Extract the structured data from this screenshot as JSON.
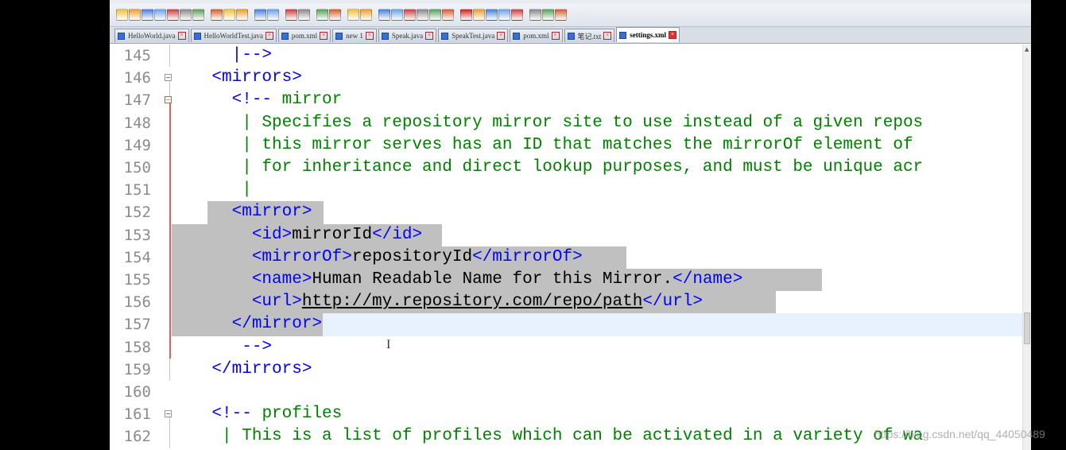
{
  "toolbar": {
    "buttons": [
      "new-file",
      "open-file",
      "save",
      "save-all",
      "close",
      "close-all",
      "print",
      "cut",
      "copy",
      "paste",
      "undo",
      "redo",
      "find",
      "replace",
      "zoom-in",
      "zoom-out",
      "sync-v",
      "sync-h",
      "word-wrap",
      "show-all-chars",
      "indent-guide",
      "user-lang",
      "doc-map",
      "function-list",
      "record-macro",
      "stop-record",
      "play-macro",
      "run-macro-multi",
      "save-macro",
      "spellcheck",
      "folder",
      "panel"
    ],
    "colors": {
      "accent": "#3a6fd0",
      "record": "#d02020"
    }
  },
  "tabs": [
    {
      "label": "HelloWorld.java",
      "active": false
    },
    {
      "label": "HelloWorldTest.java",
      "active": false
    },
    {
      "label": "pom.xml",
      "active": false
    },
    {
      "label": "new  1",
      "active": false
    },
    {
      "label": "Speak.java",
      "active": false
    },
    {
      "label": "SpeakTest.java",
      "active": false
    },
    {
      "label": "pom.xml",
      "active": false
    },
    {
      "label": "笔记.txt",
      "active": false
    },
    {
      "label": "settings.xml",
      "active": true
    }
  ],
  "editor": {
    "lines": [
      {
        "n": "145",
        "indent": "      ",
        "segments": [
          {
            "t": "|-->",
            "c": "tag"
          }
        ]
      },
      {
        "n": "146",
        "indent": "    ",
        "segments": [
          {
            "t": "<mirrors>",
            "c": "tag"
          }
        ]
      },
      {
        "n": "147",
        "indent": "      ",
        "segments": [
          {
            "t": "<!--",
            "c": "tag"
          },
          {
            "t": " mirror",
            "c": "cmt"
          }
        ]
      },
      {
        "n": "148",
        "indent": "       ",
        "segments": [
          {
            "t": "| Specifies a repository mirror site to use instead of a given repos",
            "c": "cmt"
          }
        ]
      },
      {
        "n": "149",
        "indent": "       ",
        "segments": [
          {
            "t": "| this mirror serves has an ID that matches the mirrorOf element of",
            "c": "cmt"
          }
        ]
      },
      {
        "n": "150",
        "indent": "       ",
        "segments": [
          {
            "t": "| for inheritance and direct lookup purposes, and must be unique acr",
            "c": "cmt"
          }
        ]
      },
      {
        "n": "151",
        "indent": "       ",
        "segments": [
          {
            "t": "|",
            "c": "cmt"
          }
        ]
      },
      {
        "n": "152",
        "indent": "      ",
        "segments": [
          {
            "t": "<mirror>",
            "c": "tag"
          }
        ]
      },
      {
        "n": "153",
        "indent": "        ",
        "segments": [
          {
            "t": "<id>",
            "c": "tag"
          },
          {
            "t": "mirrorId",
            "c": "txt"
          },
          {
            "t": "</id>",
            "c": "tag"
          }
        ]
      },
      {
        "n": "154",
        "indent": "        ",
        "segments": [
          {
            "t": "<mirrorOf>",
            "c": "tag"
          },
          {
            "t": "repositoryId",
            "c": "txt"
          },
          {
            "t": "</mirrorOf>",
            "c": "tag"
          }
        ]
      },
      {
        "n": "155",
        "indent": "        ",
        "segments": [
          {
            "t": "<name>",
            "c": "tag"
          },
          {
            "t": "Human Readable Name for this Mirror.",
            "c": "txt"
          },
          {
            "t": "</name>",
            "c": "tag"
          }
        ]
      },
      {
        "n": "156",
        "indent": "        ",
        "segments": [
          {
            "t": "<url>",
            "c": "tag"
          },
          {
            "t": "http://my.repository.com/repo/path",
            "c": "url"
          },
          {
            "t": "</url>",
            "c": "tag"
          }
        ]
      },
      {
        "n": "157",
        "indent": "      ",
        "segments": [
          {
            "t": "</mirror>",
            "c": "tag"
          }
        ]
      },
      {
        "n": "158",
        "indent": "       ",
        "segments": [
          {
            "t": "-->",
            "c": "tag"
          }
        ]
      },
      {
        "n": "159",
        "indent": "    ",
        "segments": [
          {
            "t": "</mirrors>",
            "c": "tag"
          }
        ]
      },
      {
        "n": "160",
        "indent": "",
        "segments": []
      },
      {
        "n": "161",
        "indent": "    ",
        "segments": [
          {
            "t": "<!--",
            "c": "tag"
          },
          {
            "t": " profiles",
            "c": "cmt"
          }
        ]
      },
      {
        "n": "162",
        "indent": "     ",
        "segments": [
          {
            "t": "| This is a list of profiles which can be activated in a variety of wa",
            "c": "cmt"
          }
        ]
      }
    ],
    "caret_glyph": "I",
    "scroll_arrow": "▲",
    "fold_open": "⊟"
  },
  "watermark": "https://blog.csdn.net/qq_44050489"
}
